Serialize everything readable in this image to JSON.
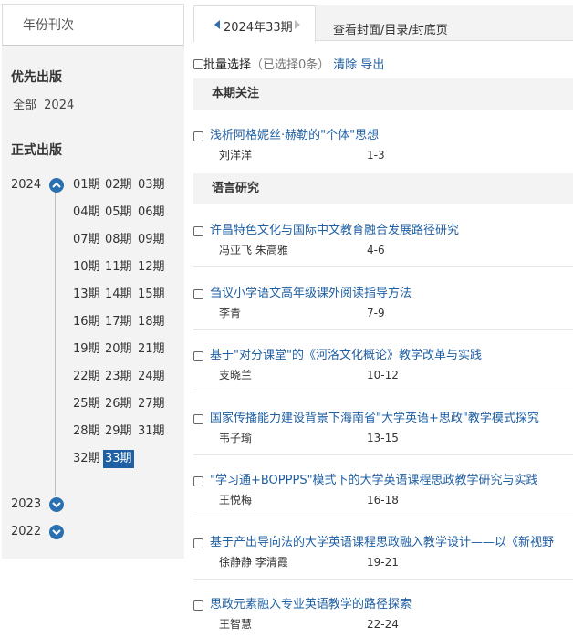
{
  "left_panel": {
    "tab_label": "年份刊次",
    "priority_title": "优先出版",
    "priority_items": [
      "全部",
      "2024"
    ],
    "formal_title": "正式出版",
    "years": [
      {
        "year": "2024",
        "expanded": true
      },
      {
        "year": "2023",
        "expanded": false
      },
      {
        "year": "2022",
        "expanded": false
      }
    ],
    "issues": [
      "01期",
      "02期",
      "03期",
      "04期",
      "05期",
      "06期",
      "07期",
      "08期",
      "09期",
      "10期",
      "11期",
      "12期",
      "13期",
      "14期",
      "15期",
      "16期",
      "17期",
      "18期",
      "19期",
      "20期",
      "21期",
      "22期",
      "23期",
      "24期",
      "25期",
      "26期",
      "27期",
      "28期",
      "29期",
      "31期",
      "32期",
      "33期"
    ],
    "active_issue": "33期"
  },
  "tabs": {
    "current_issue": "2024年33期",
    "cover_tab": "查看封面/目录/封底页"
  },
  "batch": {
    "label": "批量选择",
    "selected": "（已选择0条）",
    "clear": "清除",
    "export": "导出"
  },
  "sections": [
    {
      "name": "本期关注",
      "articles": [
        {
          "title": "浅析阿格妮丝·赫勒的\"个体\"思想",
          "authors": "刘洋洋",
          "pages": "1-3"
        }
      ]
    },
    {
      "name": "语言研究",
      "articles": [
        {
          "title": "许昌特色文化与国际中文教育融合发展路径研究",
          "authors": "冯亚飞 朱高雅",
          "pages": "4-6"
        },
        {
          "title": "刍议小学语文高年级课外阅读指导方法",
          "authors": "李青",
          "pages": "7-9"
        },
        {
          "title": "基于\"对分课堂\"的《河洛文化概论》教学改革与实践",
          "authors": "支晓兰",
          "pages": "10-12"
        },
        {
          "title": "国家传播能力建设背景下海南省\"大学英语+思政\"教学模式探究",
          "authors": "韦子瑜",
          "pages": "13-15"
        },
        {
          "title": "\"学习通+BOPPPS\"模式下的大学英语课程思政教学研究与实践",
          "authors": "王悦梅",
          "pages": "16-18"
        },
        {
          "title": "基于产出导向法的大学英语课程思政融入教学设计——以《新视野",
          "authors": "徐静静 李清霞",
          "pages": "19-21"
        },
        {
          "title": "思政元素融入专业英语教学的路径探索",
          "authors": "王智慧",
          "pages": "22-24"
        }
      ]
    }
  ],
  "colors": {
    "link": "#1f5fa3",
    "accent": "#2a6fb0",
    "panel_bg": "#f3f3f3"
  }
}
